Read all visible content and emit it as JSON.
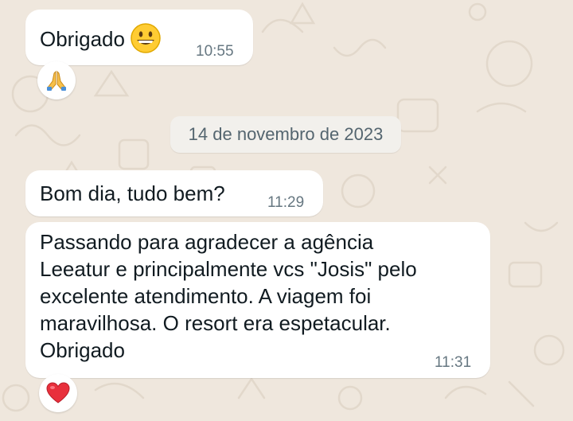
{
  "colors": {
    "wallpaper": "#efe7dd",
    "bubble": "#ffffff",
    "text": "#111b21",
    "timestamp": "#667781",
    "date_pill_bg": "#f2f0ec",
    "heart": "#e8303c"
  },
  "date_divider": "14 de novembro de 2023",
  "messages": [
    {
      "text": "Obrigado",
      "emoji_icon": "grinning-face-icon",
      "time": "10:55",
      "reaction_icon": "folded-hands-icon"
    },
    {
      "text": "Bom dia, tudo bem?",
      "time": "11:29"
    },
    {
      "lines": [
        "Passando para agradecer a agência",
        "Leeatur e principalmente vcs \"Josis\" pelo",
        "excelente atendimento. A viagem foi",
        "maravilhosa. O resort era espetacular.",
        "Obrigado"
      ],
      "time": "11:31",
      "reaction_icon": "red-heart-icon"
    }
  ]
}
